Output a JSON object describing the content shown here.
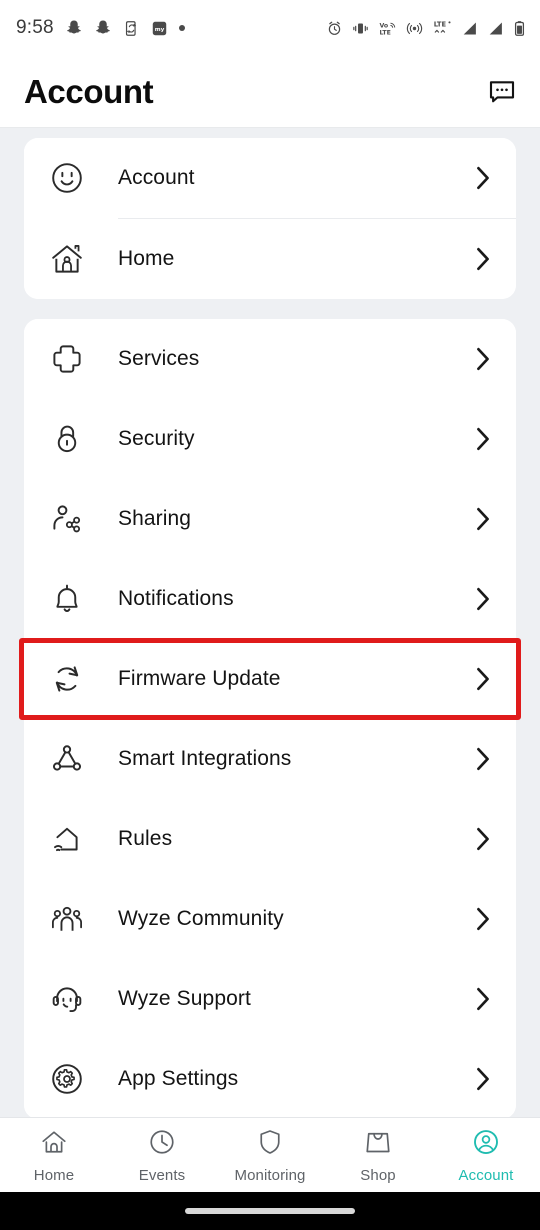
{
  "statusbar": {
    "time": "9:58",
    "left_icons": [
      "snapchat-ghost-icon",
      "snapchat-ghost-icon",
      "phone-sync-icon",
      "app-badge-icon",
      "notification-dot-icon"
    ],
    "right_icons": [
      "alarm-clock-icon",
      "vibrate-icon",
      "volte-icon",
      "hotspot-icon",
      "lte-signal-icon",
      "cellular-signal-1-icon",
      "cellular-signal-2-icon",
      "battery-icon"
    ],
    "volte_label_top": "Vo",
    "volte_label_bottom": "LTE",
    "lte_label": "LTE"
  },
  "header": {
    "title": "Account",
    "action_icon": "message-bubble-icon"
  },
  "cards": [
    {
      "id": "account-card",
      "dividers": true,
      "items": [
        {
          "label": "Account",
          "icon": "smiley-face-icon",
          "name": "account"
        },
        {
          "label": "Home",
          "icon": "house-person-icon",
          "name": "home"
        }
      ]
    },
    {
      "id": "settings-card",
      "dividers": false,
      "items": [
        {
          "label": "Services",
          "icon": "plus-cross-icon",
          "name": "services"
        },
        {
          "label": "Security",
          "icon": "padlock-icon",
          "name": "security"
        },
        {
          "label": "Sharing",
          "icon": "person-share-icon",
          "name": "sharing"
        },
        {
          "label": "Notifications",
          "icon": "bell-icon",
          "name": "notifications"
        },
        {
          "label": "Firmware Update",
          "icon": "refresh-sync-icon",
          "name": "firmware-update",
          "highlighted": true
        },
        {
          "label": "Smart Integrations",
          "icon": "node-graph-icon",
          "name": "smart-integrations"
        },
        {
          "label": "Rules",
          "icon": "house-wifi-icon",
          "name": "rules"
        },
        {
          "label": "Wyze Community",
          "icon": "people-group-icon",
          "name": "wyze-community"
        },
        {
          "label": "Wyze Support",
          "icon": "headset-support-icon",
          "name": "wyze-support"
        },
        {
          "label": "App Settings",
          "icon": "gear-circle-icon",
          "name": "app-settings"
        }
      ]
    }
  ],
  "bottom_nav": {
    "items": [
      {
        "label": "Home",
        "icon": "house-outline-icon",
        "active": false
      },
      {
        "label": "Events",
        "icon": "clock-icon",
        "active": false
      },
      {
        "label": "Monitoring",
        "icon": "shield-icon",
        "active": false
      },
      {
        "label": "Shop",
        "icon": "shopping-bag-icon",
        "active": false
      },
      {
        "label": "Account",
        "icon": "person-circle-icon",
        "active": true
      }
    ]
  },
  "colors": {
    "accent": "#1fbcb0",
    "highlight_box": "#e01b1b",
    "page_background": "#eef0f3",
    "card_background": "#ffffff",
    "text_primary": "#141414"
  },
  "chevron_glyph": "›"
}
